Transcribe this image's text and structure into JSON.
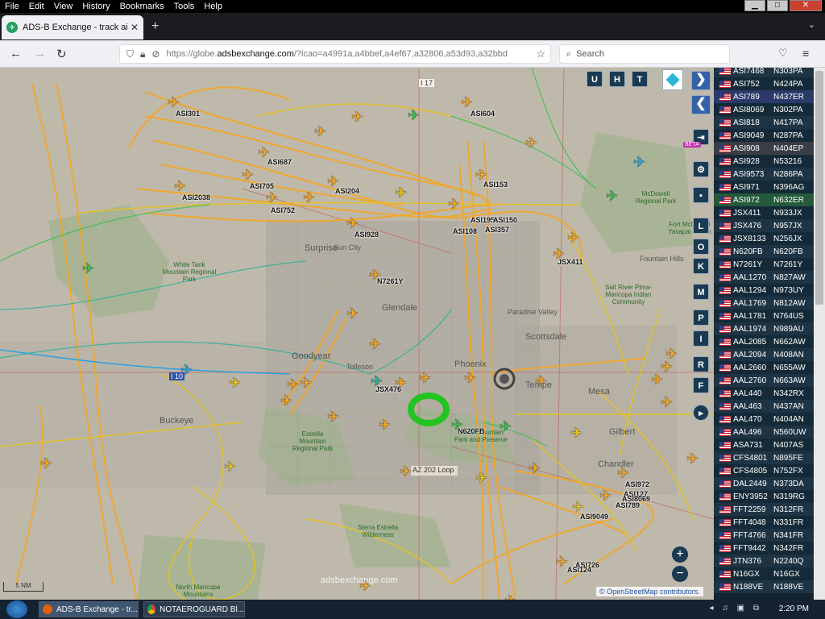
{
  "menu": [
    "File",
    "Edit",
    "View",
    "History",
    "Bookmarks",
    "Tools",
    "Help"
  ],
  "window_controls": {
    "minimize": "▁",
    "maximize": "□",
    "close": "✕"
  },
  "tab": {
    "title": "ADS-B Exchange - track aircraft",
    "favicon": "ADS-B exchange logo",
    "close": "✕",
    "new_tab": "+"
  },
  "nav": {
    "back": "←",
    "forward": "→",
    "reload": "↻",
    "url_prefix": "https://globe.",
    "url_domain": "adsbexchange.com",
    "url_rest": "/?icao=a4991a,a4bbef,a4ef67,a32806,a53d93,a32bbd",
    "search_placeholder": "Search"
  },
  "map": {
    "places": [
      {
        "name": "Surprise",
        "key": "surprise"
      },
      {
        "name": "Sun City",
        "key": "suncity"
      },
      {
        "name": "Glendale",
        "key": "glendale"
      },
      {
        "name": "Goodyear",
        "key": "goodyear"
      },
      {
        "name": "Buckeye",
        "key": "buckeye"
      },
      {
        "name": "Tolleson",
        "key": "tolleson"
      },
      {
        "name": "Phoenix",
        "key": "phoenix"
      },
      {
        "name": "Tempe",
        "key": "tempe"
      },
      {
        "name": "Scottsdale",
        "key": "scottsdale"
      },
      {
        "name": "Paradise Valley",
        "key": "paradise"
      },
      {
        "name": "Mesa",
        "key": "mesa"
      },
      {
        "name": "Gilbert",
        "key": "gilbert"
      },
      {
        "name": "Chandler",
        "key": "chandler"
      },
      {
        "name": "Fountain Hills",
        "key": "fountain"
      }
    ],
    "parks": [
      {
        "name": "White Tank Mountain Regional Park",
        "key": "whitetank"
      },
      {
        "name": "McDowell Regional Park",
        "key": "mcdowell"
      },
      {
        "name": "Estrella Mountain Regional Park",
        "key": "estrella"
      },
      {
        "name": "South Mountain Park and Preserve",
        "key": "southmtn"
      },
      {
        "name": "Sierra Estrella Wilderness",
        "key": "sierra"
      },
      {
        "name": "North Maricopa Mountains",
        "key": "northmaricopa"
      },
      {
        "name": "Salt River Pima-Maricopa Indian Community",
        "key": "saltriver"
      },
      {
        "name": "Fort McDowell Yavapai Nation",
        "key": "fortmcd"
      }
    ],
    "callsigns": [
      "ASI301",
      "ASI604",
      "ASI687",
      "ASI705",
      "ASI2038",
      "ASI204",
      "ASI752",
      "ASI153",
      "ASI928",
      "ASI195",
      "ASI150",
      "ASI108",
      "ASI357",
      "JSX411",
      "N7261Y",
      "JSX476",
      "N620FB",
      "ASI972",
      "ASI127",
      "ASI8069",
      "ASI789",
      "ASI9049",
      "ASI726",
      "ASI124"
    ],
    "highway": "AZ 202 Loop",
    "interstate_17": "I 17",
    "interstate_10": "I 10",
    "scale": "5 NM",
    "logo": "adsbexchange.com",
    "attribution": "© OpenStreetMap contributors.",
    "colors": {
      "track_main": "#f5a623",
      "track_yellow": "#e8c31a",
      "track_teal": "#29b29a",
      "track_blue": "#2aa4e0",
      "track_green": "#36c04a",
      "background": "#bfb9ab"
    }
  },
  "toolbar": {
    "top_buttons": [
      "U",
      "H",
      "T"
    ],
    "side_buttons": [
      "L",
      "O",
      "K",
      "M",
      "P",
      "I",
      "R",
      "F"
    ],
    "beta": "BETA",
    "zoom_in": "+",
    "zoom_out": "−"
  },
  "aircraft_table": [
    {
      "callsign": "ASI7468",
      "reg": "N303PA",
      "highlight": false
    },
    {
      "callsign": "ASI752",
      "reg": "N424PA",
      "highlight": false
    },
    {
      "callsign": "ASI789",
      "reg": "N437ER",
      "highlight": true
    },
    {
      "callsign": "ASI8069",
      "reg": "N302PA",
      "highlight": false
    },
    {
      "callsign": "ASI818",
      "reg": "N417PA",
      "highlight": false
    },
    {
      "callsign": "ASI9049",
      "reg": "N287PA",
      "highlight": false
    },
    {
      "callsign": "ASI908",
      "reg": "N404EP",
      "highlight": false
    },
    {
      "callsign": "ASI928",
      "reg": "N53216",
      "highlight": false
    },
    {
      "callsign": "ASI9573",
      "reg": "N286PA",
      "highlight": false
    },
    {
      "callsign": "ASI971",
      "reg": "N396AG",
      "highlight": false
    },
    {
      "callsign": "ASI972",
      "reg": "N632ER",
      "highlight": false
    },
    {
      "callsign": "JSX411",
      "reg": "N933JX",
      "highlight": false
    },
    {
      "callsign": "JSX476",
      "reg": "N957JX",
      "highlight": false
    },
    {
      "callsign": "JSX8133",
      "reg": "N256JX",
      "highlight": false
    },
    {
      "callsign": "N620FB",
      "reg": "N620FB",
      "highlight": false
    },
    {
      "callsign": "N7261Y",
      "reg": "N7261Y",
      "highlight": false
    },
    {
      "callsign": "AAL1270",
      "reg": "N827AW",
      "highlight": false
    },
    {
      "callsign": "AAL1294",
      "reg": "N973UY",
      "highlight": false
    },
    {
      "callsign": "AAL1769",
      "reg": "N812AW",
      "highlight": false
    },
    {
      "callsign": "AAL1781",
      "reg": "N764US",
      "highlight": false
    },
    {
      "callsign": "AAL1974",
      "reg": "N989AU",
      "highlight": false
    },
    {
      "callsign": "AAL2085",
      "reg": "N662AW",
      "highlight": false
    },
    {
      "callsign": "AAL2094",
      "reg": "N408AN",
      "highlight": false
    },
    {
      "callsign": "AAL2660",
      "reg": "N655AW",
      "highlight": false
    },
    {
      "callsign": "AAL2760",
      "reg": "N663AW",
      "highlight": false
    },
    {
      "callsign": "AAL440",
      "reg": "N342RX",
      "highlight": false
    },
    {
      "callsign": "AAL463",
      "reg": "N437AN",
      "highlight": false
    },
    {
      "callsign": "AAL470",
      "reg": "N404AN",
      "highlight": false
    },
    {
      "callsign": "AAL496",
      "reg": "N560UW",
      "highlight": false
    },
    {
      "callsign": "ASA731",
      "reg": "N407AS",
      "highlight": false
    },
    {
      "callsign": "CFS4801",
      "reg": "N895FE",
      "highlight": false
    },
    {
      "callsign": "CFS4805",
      "reg": "N752FX",
      "highlight": false
    },
    {
      "callsign": "DAL2449",
      "reg": "N373DA",
      "highlight": false
    },
    {
      "callsign": "ENY3952",
      "reg": "N319RG",
      "highlight": false
    },
    {
      "callsign": "FFT2259",
      "reg": "N312FR",
      "highlight": false
    },
    {
      "callsign": "FFT4048",
      "reg": "N331FR",
      "highlight": false
    },
    {
      "callsign": "FFT4766",
      "reg": "N341FR",
      "highlight": false
    },
    {
      "callsign": "FFT9442",
      "reg": "N342FR",
      "highlight": false
    },
    {
      "callsign": "JTN376",
      "reg": "N2240Q",
      "highlight": false
    },
    {
      "callsign": "N16GX",
      "reg": "N16GX",
      "highlight": false
    },
    {
      "callsign": "N188VE",
      "reg": "N188VE",
      "highlight": false
    }
  ],
  "taskbar": {
    "tasks": [
      {
        "label": "ADS-B Exchange - tr...",
        "key": "firefox"
      },
      {
        "label": "NOTAEROGUARD Bl...",
        "key": "chrome"
      }
    ],
    "clock": "2:20 PM",
    "tray": "◂ ♫ ▣ ⧉"
  }
}
